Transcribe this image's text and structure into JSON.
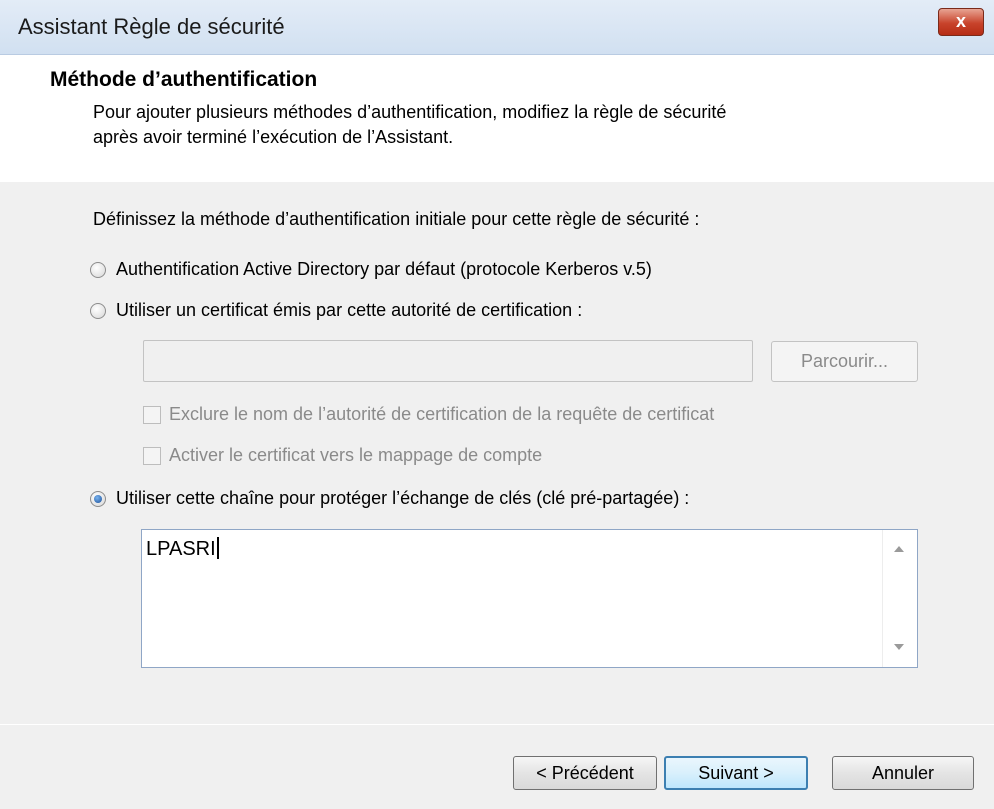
{
  "window": {
    "title": "Assistant Règle de sécurité",
    "close_label": "x"
  },
  "header": {
    "title": "Méthode d’authentification",
    "description_line1": "Pour ajouter plusieurs méthodes d’authentification, modifiez la règle de sécurité",
    "description_line2": "après avoir terminé l’exécution de l’Assistant."
  },
  "form": {
    "intro": "Définissez la méthode d’authentification initiale pour cette règle de sécurité :",
    "options": [
      {
        "label": "Authentification Active Directory par défaut (protocole Kerberos v.5)",
        "checked": false
      },
      {
        "label": "Utiliser un certificat émis par cette autorité de certification :",
        "checked": false
      },
      {
        "label": "Utiliser cette chaîne pour protéger l’échange de clés (clé pré-partagée) :",
        "checked": true
      }
    ],
    "certificate": {
      "value": "",
      "browse_label": "Parcourir...",
      "exclude_label": "Exclure le nom de l’autorité de certification de la requête de certificat",
      "mapping_label": "Activer le certificat vers le mappage de compte"
    },
    "preshared_key": {
      "value": "LPASRI"
    }
  },
  "buttons": {
    "previous": "< Précédent",
    "next": "Suivant >",
    "cancel": "Annuler"
  }
}
